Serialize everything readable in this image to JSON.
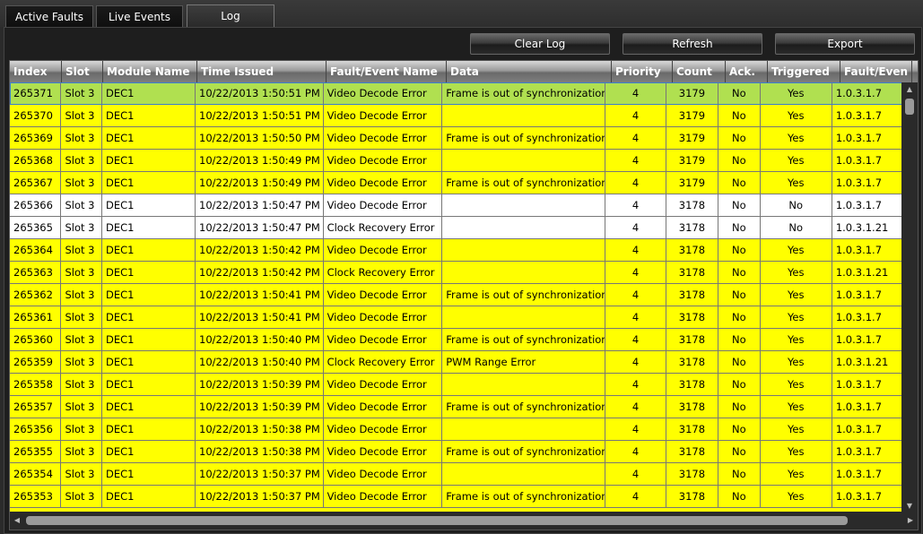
{
  "tabs": [
    {
      "label": "Active Faults"
    },
    {
      "label": "Live Events"
    },
    {
      "label": "Log"
    }
  ],
  "toolbar": {
    "clear_label": "Clear Log",
    "refresh_label": "Refresh",
    "export_label": "Export"
  },
  "table": {
    "columns": [
      "Index",
      "Slot",
      "Module Name",
      "Time Issued",
      "Fault/Event Name",
      "Data",
      "Priority",
      "Count",
      "Ack.",
      "Triggered",
      "Fault/Even"
    ],
    "rows": [
      [
        "265371",
        "Slot 3",
        "DEC1",
        "10/22/2013 1:50:51 PM",
        "Video Decode Error",
        "Frame is out of synchronization",
        "4",
        "3179",
        "No",
        "Yes",
        "1.0.3.1.7"
      ],
      [
        "265370",
        "Slot 3",
        "DEC1",
        "10/22/2013 1:50:51 PM",
        "Video Decode Error",
        "",
        "4",
        "3179",
        "No",
        "Yes",
        "1.0.3.1.7"
      ],
      [
        "265369",
        "Slot 3",
        "DEC1",
        "10/22/2013 1:50:50 PM",
        "Video Decode Error",
        "Frame is out of synchronization",
        "4",
        "3179",
        "No",
        "Yes",
        "1.0.3.1.7"
      ],
      [
        "265368",
        "Slot 3",
        "DEC1",
        "10/22/2013 1:50:49 PM",
        "Video Decode Error",
        "",
        "4",
        "3179",
        "No",
        "Yes",
        "1.0.3.1.7"
      ],
      [
        "265367",
        "Slot 3",
        "DEC1",
        "10/22/2013 1:50:49 PM",
        "Video Decode Error",
        "Frame is out of synchronization",
        "4",
        "3179",
        "No",
        "Yes",
        "1.0.3.1.7"
      ],
      [
        "265366",
        "Slot 3",
        "DEC1",
        "10/22/2013 1:50:47 PM",
        "Video Decode Error",
        "",
        "4",
        "3178",
        "No",
        "No",
        "1.0.3.1.7"
      ],
      [
        "265365",
        "Slot 3",
        "DEC1",
        "10/22/2013 1:50:47 PM",
        "Clock Recovery Error",
        "",
        "4",
        "3178",
        "No",
        "No",
        "1.0.3.1.21"
      ],
      [
        "265364",
        "Slot 3",
        "DEC1",
        "10/22/2013 1:50:42 PM",
        "Video Decode Error",
        "",
        "4",
        "3178",
        "No",
        "Yes",
        "1.0.3.1.7"
      ],
      [
        "265363",
        "Slot 3",
        "DEC1",
        "10/22/2013 1:50:42 PM",
        "Clock Recovery Error",
        "",
        "4",
        "3178",
        "No",
        "Yes",
        "1.0.3.1.21"
      ],
      [
        "265362",
        "Slot 3",
        "DEC1",
        "10/22/2013 1:50:41 PM",
        "Video Decode Error",
        "Frame is out of synchronization",
        "4",
        "3178",
        "No",
        "Yes",
        "1.0.3.1.7"
      ],
      [
        "265361",
        "Slot 3",
        "DEC1",
        "10/22/2013 1:50:41 PM",
        "Video Decode Error",
        "",
        "4",
        "3178",
        "No",
        "Yes",
        "1.0.3.1.7"
      ],
      [
        "265360",
        "Slot 3",
        "DEC1",
        "10/22/2013 1:50:40 PM",
        "Video Decode Error",
        "Frame is out of synchronization",
        "4",
        "3178",
        "No",
        "Yes",
        "1.0.3.1.7"
      ],
      [
        "265359",
        "Slot 3",
        "DEC1",
        "10/22/2013 1:50:40 PM",
        "Clock Recovery Error",
        "PWM Range Error",
        "4",
        "3178",
        "No",
        "Yes",
        "1.0.3.1.21"
      ],
      [
        "265358",
        "Slot 3",
        "DEC1",
        "10/22/2013 1:50:39 PM",
        "Video Decode Error",
        "",
        "4",
        "3178",
        "No",
        "Yes",
        "1.0.3.1.7"
      ],
      [
        "265357",
        "Slot 3",
        "DEC1",
        "10/22/2013 1:50:39 PM",
        "Video Decode Error",
        "Frame is out of synchronization",
        "4",
        "3178",
        "No",
        "Yes",
        "1.0.3.1.7"
      ],
      [
        "265356",
        "Slot 3",
        "DEC1",
        "10/22/2013 1:50:38 PM",
        "Video Decode Error",
        "",
        "4",
        "3178",
        "No",
        "Yes",
        "1.0.3.1.7"
      ],
      [
        "265355",
        "Slot 3",
        "DEC1",
        "10/22/2013 1:50:38 PM",
        "Video Decode Error",
        "Frame is out of synchronization",
        "4",
        "3178",
        "No",
        "Yes",
        "1.0.3.1.7"
      ],
      [
        "265354",
        "Slot 3",
        "DEC1",
        "10/22/2013 1:50:37 PM",
        "Video Decode Error",
        "",
        "4",
        "3178",
        "No",
        "Yes",
        "1.0.3.1.7"
      ],
      [
        "265353",
        "Slot 3",
        "DEC1",
        "10/22/2013 1:50:37 PM",
        "Video Decode Error",
        "Frame is out of synchronization",
        "4",
        "3178",
        "No",
        "Yes",
        "1.0.3.1.7"
      ]
    ],
    "row_styles": [
      "selected",
      "yellow",
      "yellow",
      "yellow",
      "yellow",
      "white",
      "white",
      "yellow",
      "yellow",
      "yellow",
      "yellow",
      "yellow",
      "yellow",
      "yellow",
      "yellow",
      "yellow",
      "yellow",
      "yellow",
      "yellow"
    ]
  },
  "colors": {
    "triggered_row": "#ffff00",
    "untriggered_row": "#ffffff",
    "selected_row": "#b0e050"
  },
  "icons": {
    "scroll_up": "up-arrow-icon",
    "scroll_down": "down-arrow-icon",
    "scroll_left": "left-arrow-icon",
    "scroll_right": "right-arrow-icon"
  }
}
